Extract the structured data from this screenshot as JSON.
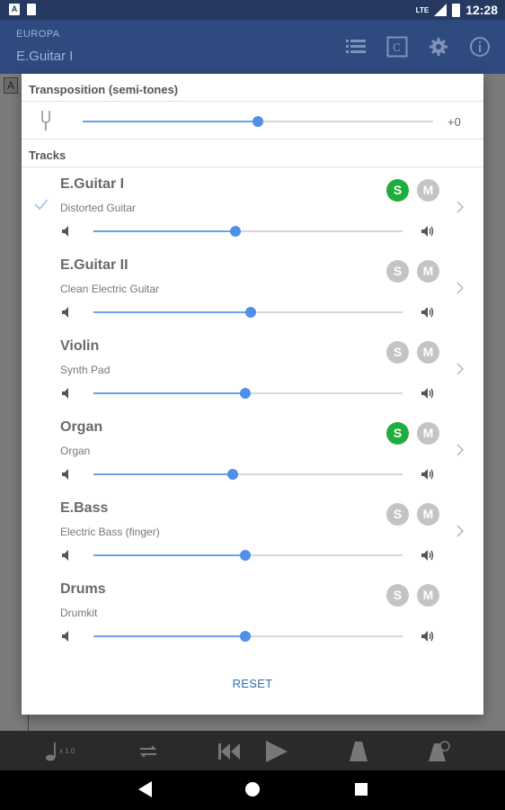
{
  "status_bar": {
    "time": "12:28",
    "network": "LTE"
  },
  "app_bar": {
    "subtitle": "EUROPA",
    "title": "E.Guitar I"
  },
  "backdrop": {
    "edge_label": "A"
  },
  "dialog": {
    "transposition": {
      "title": "Transposition (semi-tones)",
      "value_label": "+0",
      "level": 0.5
    },
    "tracks_title": "Tracks",
    "solo_label": "S",
    "mute_label": "M",
    "tracks": [
      {
        "name": "E.Guitar I",
        "instrument": "Distorted Guitar",
        "volume": 0.46,
        "solo": true,
        "selected": true,
        "has_chevron": true
      },
      {
        "name": "E.Guitar II",
        "instrument": "Clean Electric Guitar",
        "volume": 0.51,
        "solo": false,
        "selected": false,
        "has_chevron": true
      },
      {
        "name": "Violin",
        "instrument": "Synth Pad",
        "volume": 0.49,
        "solo": false,
        "selected": false,
        "has_chevron": true
      },
      {
        "name": "Organ",
        "instrument": "Organ",
        "volume": 0.45,
        "solo": true,
        "selected": false,
        "has_chevron": true
      },
      {
        "name": "E.Bass",
        "instrument": "Electric Bass (finger)",
        "volume": 0.49,
        "solo": false,
        "selected": false,
        "has_chevron": true
      },
      {
        "name": "Drums",
        "instrument": "Drumkit",
        "volume": 0.49,
        "solo": false,
        "selected": false,
        "has_chevron": false
      }
    ],
    "reset_label": "RESET"
  },
  "toolbar": {
    "speed_label": "x 1.0"
  },
  "colors": {
    "accent": "#4f8fe6",
    "solo_on": "#1fae3e",
    "button_off": "#c4c4c4",
    "app_bar": "#2e4a7f"
  }
}
